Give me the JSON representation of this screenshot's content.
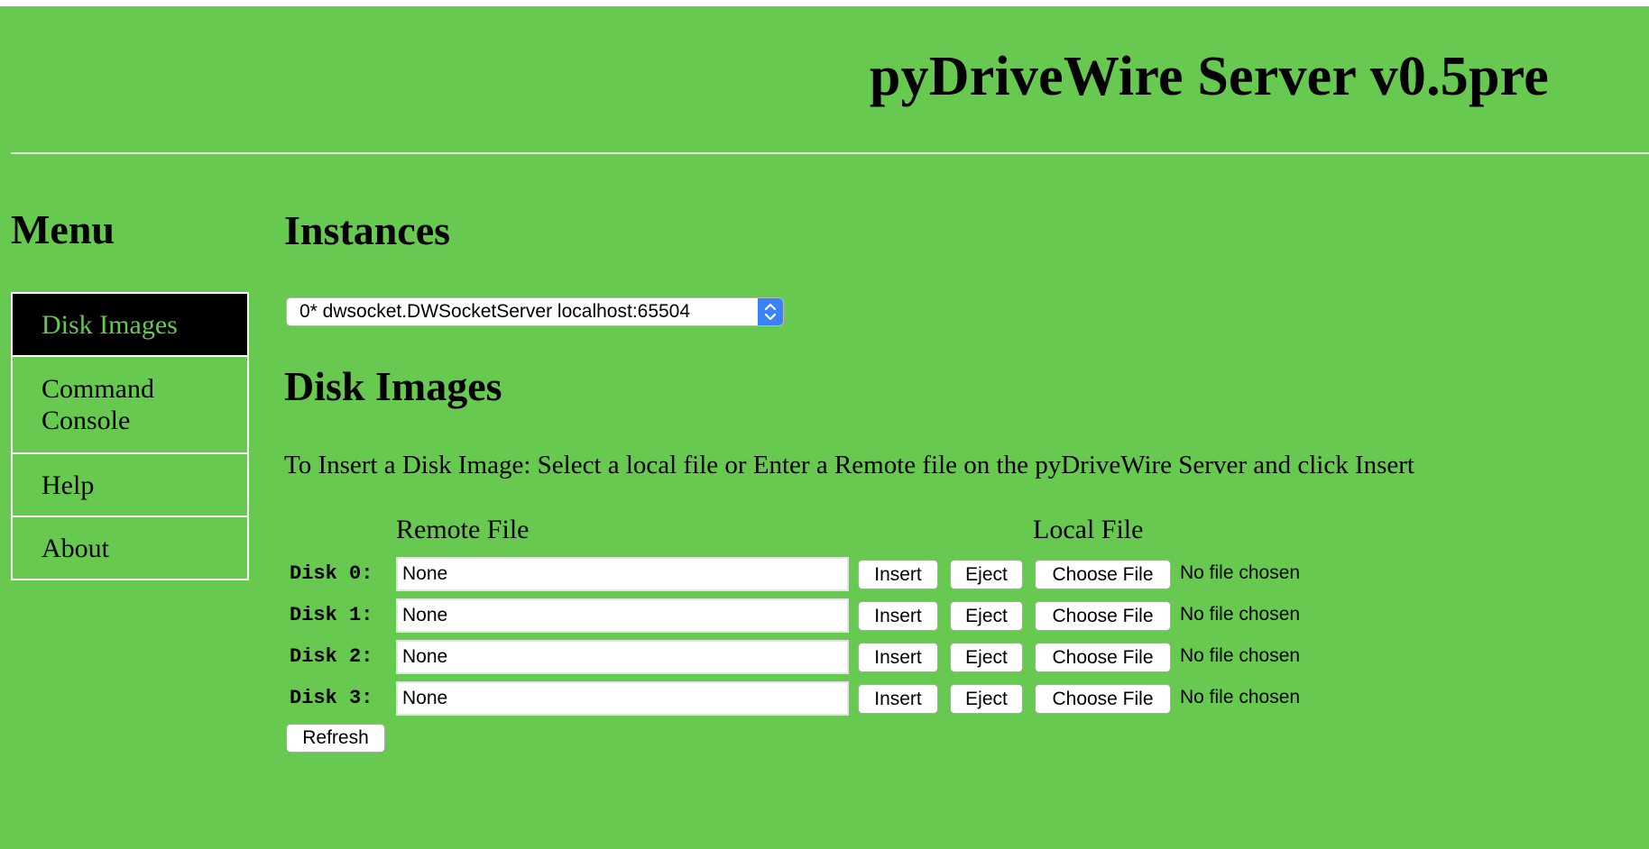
{
  "colors": {
    "page_background": "#67c94f",
    "menu_active_background": "#000000",
    "menu_active_text": "#67c94f",
    "select_arrow_accent": "#3a82f7"
  },
  "header": {
    "title": "pyDriveWire Server v0.5pre"
  },
  "menu": {
    "heading": "Menu",
    "items": [
      {
        "label": "Disk Images",
        "active": true
      },
      {
        "label": "Command Console",
        "active": false
      },
      {
        "label": "Help",
        "active": false
      },
      {
        "label": "About",
        "active": false
      }
    ]
  },
  "instances": {
    "heading": "Instances",
    "selected": "0* dwsocket.DWSocketServer localhost:65504",
    "arrow_icon": "chevron-up-down-icon"
  },
  "disk_images": {
    "heading": "Disk Images",
    "instructions": "To Insert a Disk Image: Select a local file or Enter a Remote file on the pyDriveWire Server and click Insert",
    "remote_column": "Remote File",
    "local_column": "Local File",
    "rows": [
      {
        "label": "Disk 0:",
        "remote_value": "None",
        "insert_label": "Insert",
        "eject_label": "Eject",
        "choose_label": "Choose File",
        "local_status": "No file chosen"
      },
      {
        "label": "Disk 1:",
        "remote_value": "None",
        "insert_label": "Insert",
        "eject_label": "Eject",
        "choose_label": "Choose File",
        "local_status": "No file chosen"
      },
      {
        "label": "Disk 2:",
        "remote_value": "None",
        "insert_label": "Insert",
        "eject_label": "Eject",
        "choose_label": "Choose File",
        "local_status": "No file chosen"
      },
      {
        "label": "Disk 3:",
        "remote_value": "None",
        "insert_label": "Insert",
        "eject_label": "Eject",
        "choose_label": "Choose File",
        "local_status": "No file chosen"
      }
    ],
    "refresh_label": "Refresh"
  }
}
